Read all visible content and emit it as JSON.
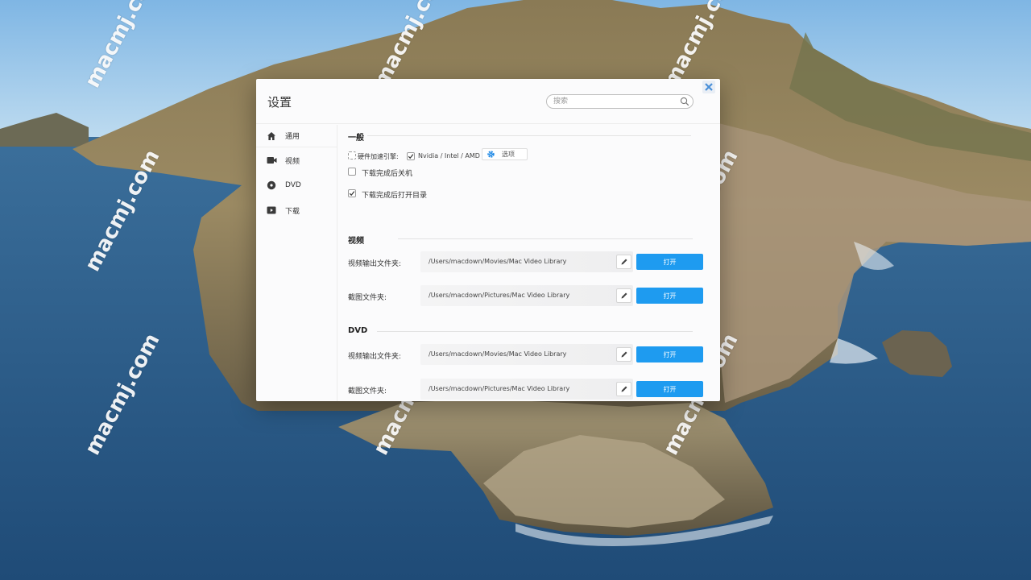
{
  "window": {
    "title": "设置",
    "search_placeholder": "搜索"
  },
  "sidebar": {
    "items": [
      {
        "label": "通用",
        "icon": "home-icon"
      },
      {
        "label": "视频",
        "icon": "video-camera-icon"
      },
      {
        "label": "DVD",
        "icon": "disc-icon"
      },
      {
        "label": "下载",
        "icon": "play-download-icon"
      }
    ]
  },
  "general": {
    "title": "一般",
    "hw_accel_label": "硬件加速引擎:",
    "hw_accel_value": "Nvidia / Intel / AMD",
    "hw_accel_checked": true,
    "options_button": "选项",
    "shutdown_label": "下载完成后关机",
    "shutdown_checked": false,
    "open_dir_label": "下载完成后打开目录",
    "open_dir_checked": true
  },
  "video": {
    "title": "视频",
    "rows": [
      {
        "label": "视频输出文件夹:",
        "path": "/Users/macdown/Movies/Mac Video Library",
        "button": "打开"
      },
      {
        "label": "截图文件夹:",
        "path": "/Users/macdown/Pictures/Mac Video Library",
        "button": "打开"
      }
    ]
  },
  "dvd": {
    "title": "DVD",
    "rows": [
      {
        "label": "视频输出文件夹:",
        "path": "/Users/macdown/Movies/Mac Video Library",
        "button": "打开"
      },
      {
        "label": "截图文件夹:",
        "path": "/Users/macdown/Pictures/Mac Video Library",
        "button": "打开"
      }
    ]
  },
  "watermark": "macmj.com",
  "colors": {
    "accent": "#1e9bf0",
    "close_icon": "#4a8fd8"
  }
}
